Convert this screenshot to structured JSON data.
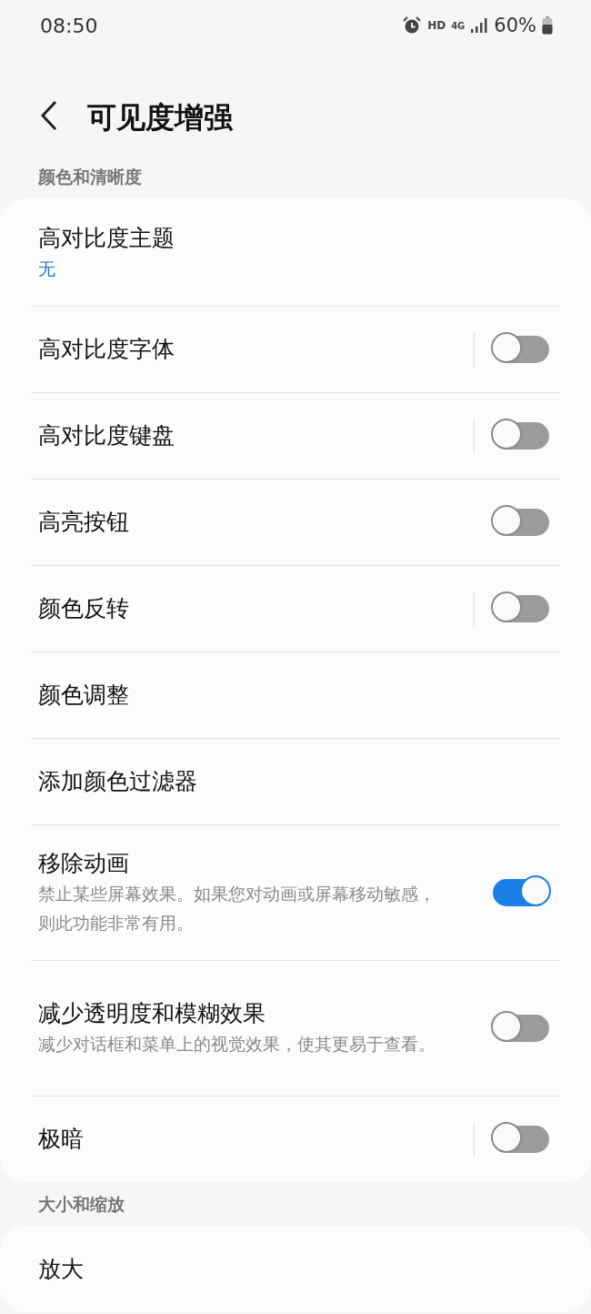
{
  "status_bar": {
    "time": "08:50",
    "network": "HD",
    "data": "4G",
    "battery": "60%"
  },
  "header": {
    "title": "可见度增强"
  },
  "sections": [
    {
      "title": "颜色和清晰度",
      "items": [
        {
          "kind": "link",
          "label": "高对比度主题",
          "value": "无"
        },
        {
          "kind": "toggle",
          "label": "高对比度字体",
          "split": true,
          "on": false
        },
        {
          "kind": "toggle",
          "label": "高对比度键盘",
          "split": true,
          "on": false
        },
        {
          "kind": "toggle",
          "label": "高亮按钮",
          "split": false,
          "on": false
        },
        {
          "kind": "toggle",
          "label": "颜色反转",
          "split": true,
          "on": false
        },
        {
          "kind": "link",
          "label": "颜色调整"
        },
        {
          "kind": "link",
          "label": "添加颜色过滤器"
        },
        {
          "kind": "toggle",
          "label": "移除动画",
          "description": "禁止某些屏幕效果。如果您对动画或屏幕移动敏感，则此功能非常有用。",
          "split": false,
          "on": true
        },
        {
          "kind": "toggle",
          "label": "减少透明度和模糊效果",
          "description": "减少对话框和菜单上的视觉效果，使其更易于查看。",
          "split": false,
          "on": false
        },
        {
          "kind": "toggle",
          "label": "极暗",
          "split": true,
          "on": false
        }
      ]
    },
    {
      "title": "大小和缩放",
      "items": [
        {
          "kind": "link",
          "label": "放大"
        }
      ]
    }
  ]
}
